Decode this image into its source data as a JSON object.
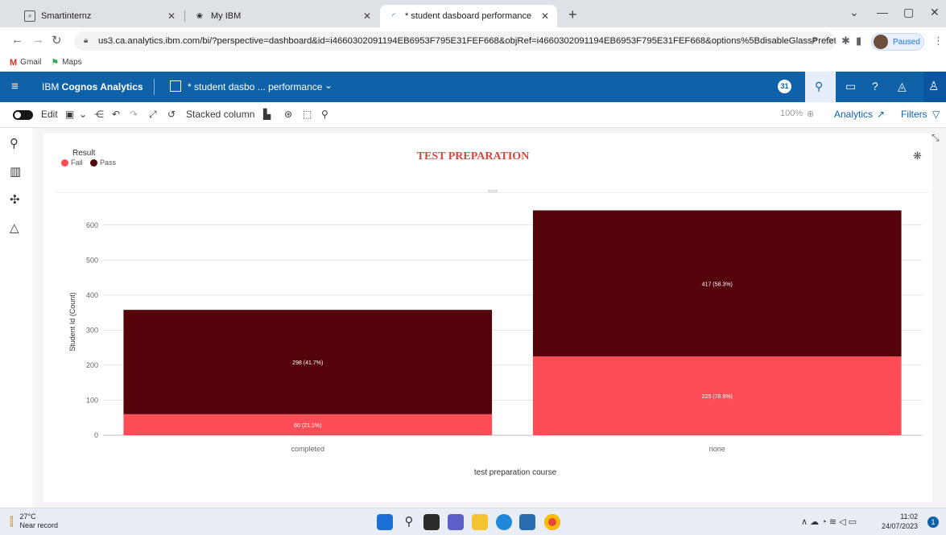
{
  "browser": {
    "tabs": [
      {
        "title": "Smartinternz",
        "active": false
      },
      {
        "title": "My IBM",
        "active": false
      },
      {
        "title": "* student dasboard performance",
        "active": true
      }
    ],
    "url": "us3.ca.analytics.ibm.com/bi/?perspective=dashboard&id=i4660302091194EB6953F795E31FEF668&objRef=i4660302091194EB6953F795E31FEF668&options%5BdisableGlassPrefetch...",
    "profile_status": "Paused",
    "bookmarks": [
      "Gmail",
      "Maps"
    ]
  },
  "app": {
    "brand_prefix": "IBM ",
    "brand_name": "Cognos Analytics",
    "dashboard_title": "* student dasbo ... performance",
    "notification_count": "31"
  },
  "toolbar": {
    "edit_label": "Edit",
    "visualization_label": "Stacked column",
    "zoom_label": "100%",
    "analytics_label": "Analytics",
    "filters_label": "Filters"
  },
  "chart_data": {
    "type": "bar",
    "stacked": true,
    "title": "TEST PREPARATION",
    "legend_title": "Result",
    "legend_position": "top-left",
    "xlabel": "test preparation course",
    "ylabel": "Student Id (Count)",
    "categories": [
      "completed",
      "none"
    ],
    "ylim": [
      0,
      650
    ],
    "yticks": [
      0,
      100,
      200,
      300,
      400,
      500,
      600
    ],
    "grid": true,
    "series": [
      {
        "name": "Fail",
        "color": "#ff4d57",
        "values": [
          60,
          225
        ],
        "labels": [
          "60 (21.1%)",
          "225 (78.9%)"
        ]
      },
      {
        "name": "Pass",
        "color": "#55040b",
        "values": [
          298,
          417
        ],
        "labels": [
          "298 (41.7%)",
          "417 (58.3%)"
        ]
      }
    ]
  },
  "taskbar": {
    "temperature": "27°C",
    "weather_note": "Near record",
    "time": "11:02",
    "date": "24/07/2023",
    "notification_count": "1"
  }
}
